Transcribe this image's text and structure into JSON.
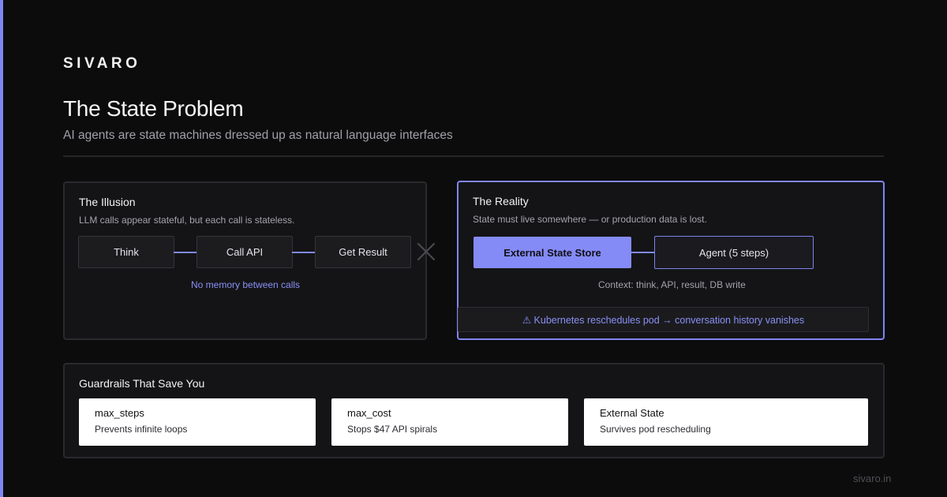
{
  "brand": "SIVARO",
  "title": "The State Problem",
  "subtitle": "AI agents are state machines dressed up as natural language interfaces",
  "illusion": {
    "title": "The Illusion",
    "description": "LLM calls appear stateful, but each call is stateless.",
    "steps": [
      "Think",
      "Call API",
      "Get Result"
    ],
    "note": "No memory between calls"
  },
  "reality": {
    "title": "The Reality",
    "description": "State must live somewhere — or production data is lost.",
    "store": "External State Store",
    "agent": "Agent (5 steps)",
    "context": "Context: think, API, result, DB write",
    "warning": "⚠ Kubernetes reschedules pod → conversation history vanishes"
  },
  "guardrails": {
    "title": "Guardrails That Save You",
    "cards": [
      {
        "title": "max_steps",
        "description": "Prevents infinite loops"
      },
      {
        "title": "max_cost",
        "description": "Stops $47 API spirals"
      },
      {
        "title": "External State",
        "description": "Survives pod rescheduling"
      }
    ]
  },
  "footer": "sivaro.in",
  "colors": {
    "accent": "#858bf6",
    "background": "#0c0c0d",
    "panel": "#141416"
  }
}
